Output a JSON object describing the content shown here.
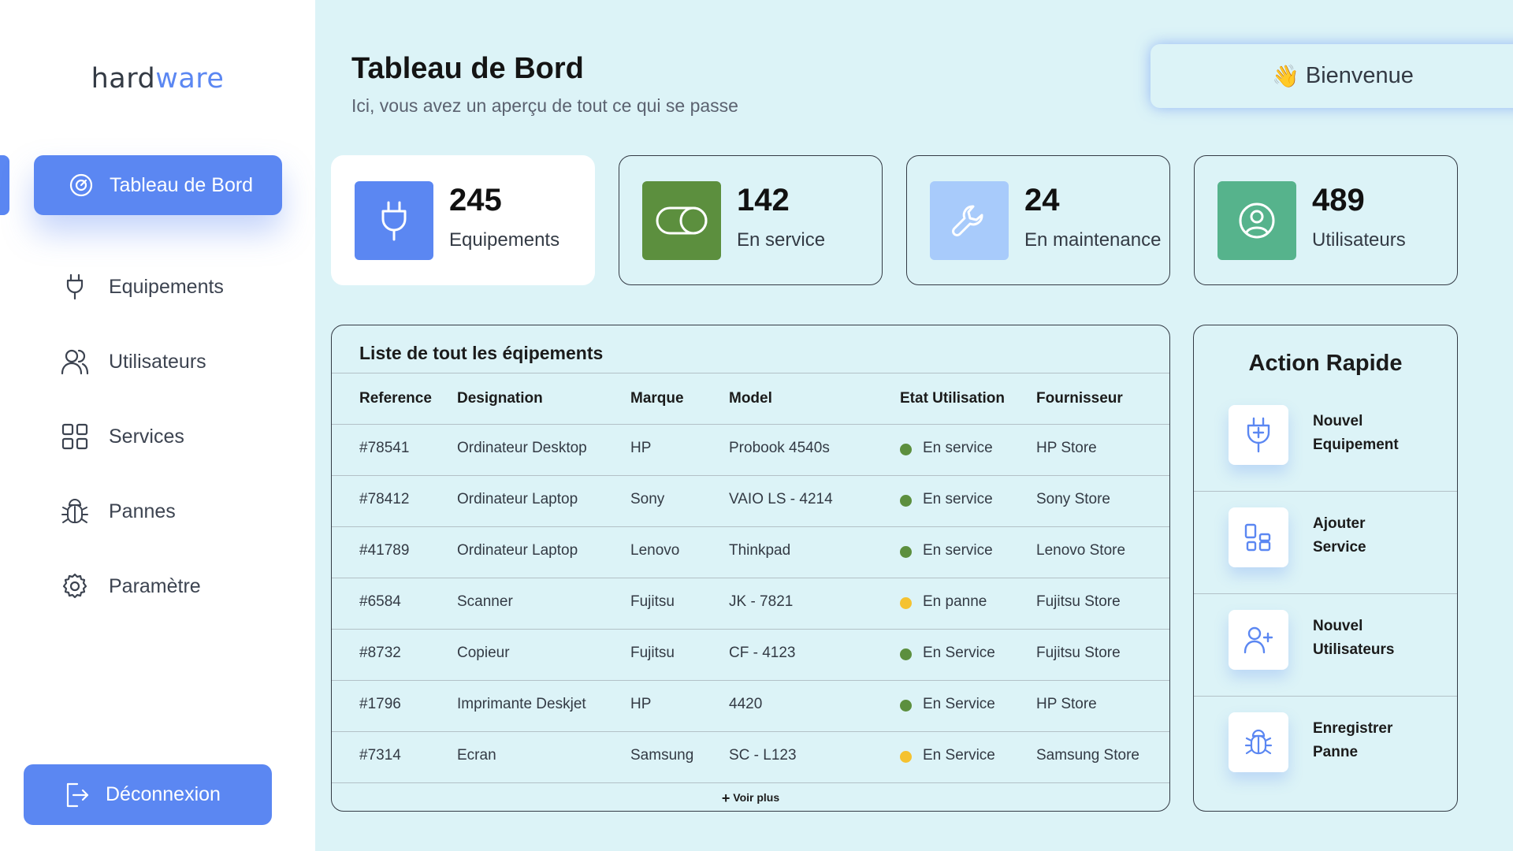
{
  "brand": {
    "part1": "hard",
    "part2": "ware"
  },
  "colors": {
    "accent": "#5b87f2",
    "service_green": "#5c8f3e",
    "panne_yellow": "#f5c230",
    "sidebar_bg": "#ffffff",
    "main_bg": "#dcf3f7"
  },
  "sidebar": {
    "active": {
      "label": "Tableau de Bord",
      "icon": "dashboard-icon"
    },
    "items": [
      {
        "label": "Equipements",
        "icon": "plug-icon"
      },
      {
        "label": "Utilisateurs",
        "icon": "users-icon"
      },
      {
        "label": "Services",
        "icon": "grid-icon"
      },
      {
        "label": "Pannes",
        "icon": "bug-icon"
      },
      {
        "label": "Paramètre",
        "icon": "gear-icon"
      }
    ],
    "logout": {
      "label": "Déconnexion",
      "icon": "logout-icon"
    }
  },
  "header": {
    "title": "Tableau de Bord",
    "subtitle": "Ici, vous avez un aperçu de tout ce qui se passe",
    "welcome": {
      "emoji": "👋",
      "label": "Bienvenue"
    }
  },
  "stats": [
    {
      "value": "245",
      "label": "Equipements",
      "icon": "plug-icon",
      "color": "#5b87f2"
    },
    {
      "value": "142",
      "label": "En service",
      "icon": "toggle-icon",
      "color": "#5c8f3e"
    },
    {
      "value": "24",
      "label": "En maintenance",
      "icon": "wrench-icon",
      "color": "#a8cbfb"
    },
    {
      "value": "489",
      "label": "Utilisateurs",
      "icon": "user-circle-icon",
      "color": "#56b38c"
    }
  ],
  "table": {
    "title": "Liste de tout les éqipements",
    "headers": [
      "Reference",
      "Designation",
      "Marque",
      "Model",
      "Etat Utilisation",
      "Fournisseur"
    ],
    "rows": [
      [
        "#78541",
        "Ordinateur Desktop",
        "HP",
        "Probook 4540s",
        "En service",
        "HP Store"
      ],
      [
        "#78412",
        "Ordinateur Laptop",
        "Sony",
        "VAIO LS - 4214",
        "En service",
        "Sony Store"
      ],
      [
        "#41789",
        "Ordinateur Laptop",
        "Lenovo",
        "Thinkpad",
        "En service",
        "Lenovo Store"
      ],
      [
        "#6584",
        "Scanner",
        "Fujitsu",
        "JK - 7821",
        "En panne",
        "Fujitsu Store"
      ],
      [
        "#8732",
        "Copieur",
        "Fujitsu",
        "CF - 4123",
        "En Service",
        "Fujitsu Store"
      ],
      [
        "#1796",
        "Imprimante Deskjet",
        "HP",
        "4420",
        "En Service",
        "HP Store"
      ],
      [
        "#7314",
        "Ecran",
        "Samsung",
        "SC - L123",
        "En Service",
        "Samsung Store"
      ]
    ],
    "status_colors": [
      "#5c8f3e",
      "#5c8f3e",
      "#5c8f3e",
      "#f5c230",
      "#5c8f3e",
      "#5c8f3e",
      "#f5c230"
    ],
    "more": "Voir plus"
  },
  "quick_actions": {
    "title": "Action Rapide",
    "items": [
      {
        "line1": "Nouvel",
        "line2": "Equipement",
        "icon": "plug-plus-icon"
      },
      {
        "line1": "Ajouter",
        "line2": "Service",
        "icon": "grid-icon"
      },
      {
        "line1": "Nouvel",
        "line2": "Utilisateurs",
        "icon": "user-plus-icon"
      },
      {
        "line1": "Enregistrer",
        "line2": "Panne",
        "icon": "bug-icon"
      }
    ]
  }
}
